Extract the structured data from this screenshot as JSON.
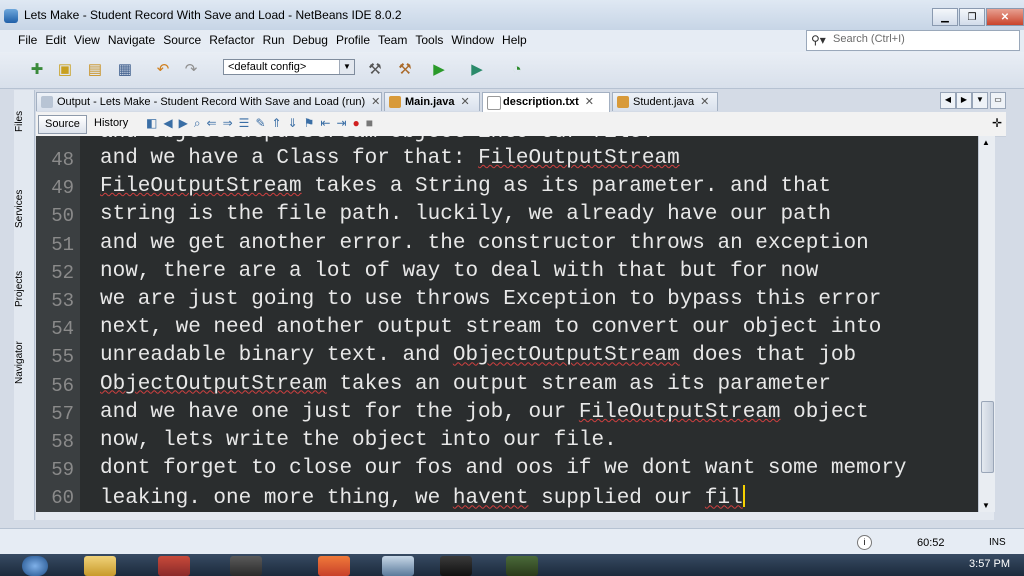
{
  "window": {
    "title": "Lets Make - Student Record With Save and Load - NetBeans IDE 8.0.2"
  },
  "menu": [
    "File",
    "Edit",
    "View",
    "Navigate",
    "Source",
    "Refactor",
    "Run",
    "Debug",
    "Profile",
    "Team",
    "Tools",
    "Window",
    "Help"
  ],
  "search": {
    "placeholder": "Search (Ctrl+I)"
  },
  "toolbar": {
    "config": "<default config>"
  },
  "side_tabs": [
    "Files",
    "Services",
    "Projects",
    "Navigator"
  ],
  "tabs": [
    {
      "label": "Output - Lets Make - Student Record With Save and Load (run)"
    },
    {
      "label": "Main.java"
    },
    {
      "label": "description.txt"
    },
    {
      "label": "Student.java"
    }
  ],
  "editor_toolbar": {
    "source": "Source",
    "history": "History"
  },
  "editor": {
    "partial_line": "now, lets write the object into our file.",
    "lines": [
      {
        "n": "48",
        "text": "and we have a Class for that: FileOutputStream"
      },
      {
        "n": "49",
        "text": "FileOutputStream takes a String as its parameter. and that"
      },
      {
        "n": "50",
        "text": "string is the file path. luckily, we already have our path"
      },
      {
        "n": "51",
        "text": "and we get another error. the constructor throws an exception"
      },
      {
        "n": "52",
        "text": "now, there are a lot of way to deal with that but for now"
      },
      {
        "n": "53",
        "text": "we are just going to use throws Exception to bypass this error"
      },
      {
        "n": "54",
        "text": "next, we need another output stream to convert our object into"
      },
      {
        "n": "55",
        "text": "unreadable binary text. and ObjectOutputStream does that job"
      },
      {
        "n": "56",
        "text": "ObjectOutputStream takes an output stream as its parameter"
      },
      {
        "n": "57",
        "text": "and we have one just for the job, our FileOutputStream object"
      },
      {
        "n": "58",
        "text": "now, lets write the object into our file."
      },
      {
        "n": "59",
        "text": "dont forget to close our fos and oos if we dont want some memory"
      },
      {
        "n": "60",
        "text": "leaking. one more thing, we havent supplied our fil"
      }
    ]
  },
  "status": {
    "position": "60:52",
    "mode": "INS"
  },
  "taskbar": {
    "clock": "3:57 PM"
  }
}
